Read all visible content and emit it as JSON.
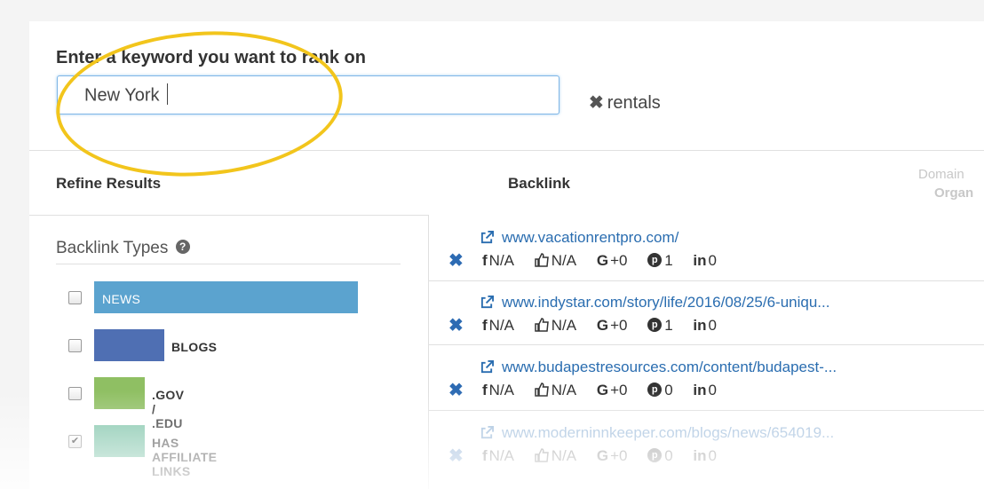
{
  "keyword": {
    "label": "Enter a keyword you want to rank on",
    "value": "New York",
    "tag": "rentals"
  },
  "headers": {
    "refine": "Refine Results",
    "backlink": "Backlink",
    "domain_line1": "Domain",
    "domain_line2": "Organ"
  },
  "filters": {
    "title": "Backlink Types",
    "items": [
      {
        "label": "NEWS",
        "checked": false,
        "color": "#5ba3cf",
        "level": 1.0
      },
      {
        "label": "BLOGS",
        "checked": false,
        "color": "#4f6fb3",
        "level": 0.27
      },
      {
        "label": ".GOV / .EDU",
        "checked": false,
        "color": "#8fbf63",
        "level": 0.19
      },
      {
        "label": "HAS AFFILIATE LINKS",
        "checked": true,
        "color": "#7fc4a9",
        "level": 0.19
      }
    ]
  },
  "results": [
    {
      "url": "www.vacationrentpro.com/",
      "fb": "N/A",
      "likes": "N/A",
      "gplus": "+0",
      "pin": "1",
      "li": "0"
    },
    {
      "url": "www.indystar.com/story/life/2016/08/25/6-uniqu...",
      "fb": "N/A",
      "likes": "N/A",
      "gplus": "+0",
      "pin": "1",
      "li": "0"
    },
    {
      "url": "www.budapestresources.com/content/budapest-...",
      "fb": "N/A",
      "likes": "N/A",
      "gplus": "+0",
      "pin": "0",
      "li": "0"
    },
    {
      "url": "www.moderninnkeeper.com/blogs/news/654019...",
      "fb": "N/A",
      "likes": "N/A",
      "gplus": "+0",
      "pin": "0",
      "li": "0"
    }
  ],
  "icons": {
    "remove": "close-icon",
    "external": "external-link-icon",
    "facebook": "facebook-icon",
    "like": "thumbs-up-icon",
    "gplus": "google-plus-icon",
    "pinterest": "pinterest-icon",
    "linkedin": "linkedin-icon"
  },
  "colors": {
    "highlight_oval": "#f2c51c",
    "link": "#2a6db0",
    "remove": "#2d6bb3"
  }
}
